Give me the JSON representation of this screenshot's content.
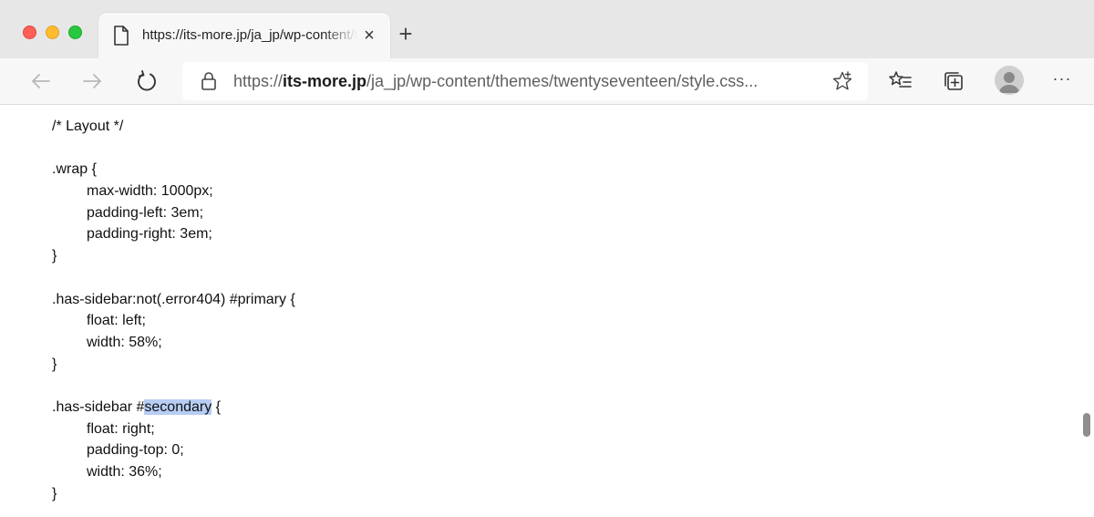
{
  "browser": {
    "tab": {
      "title": "https://its-more.jp/ja_jp/wp-content/themes/twentyseventeen/style.css",
      "close_glyph": "×",
      "icon": "page-icon"
    },
    "new_tab_glyph": "+",
    "toolbar": {
      "url_prefix": "https://",
      "url_domain": "its-more.jp",
      "url_path": "/ja_jp/wp-content/themes/twentyseventeen/style.css...",
      "more_glyph": "···",
      "icons": [
        "back-arrow-icon",
        "forward-arrow-icon",
        "refresh-icon",
        "lock-icon",
        "star-icon",
        "favorites-list-icon",
        "collections-icon",
        "profile-icon",
        "more-icon"
      ]
    }
  },
  "code": {
    "l1": "/* Layout */",
    "l2": "",
    "l3": ".wrap {",
    "l4": "max-width: 1000px;",
    "l5": "padding-left: 3em;",
    "l6": "padding-right: 3em;",
    "l7": "}",
    "l8": "",
    "l9": ".has-sidebar:not(.error404) #primary {",
    "l10": "float: left;",
    "l11": "width: 58%;",
    "l12": "}",
    "l13": "",
    "l14_before": ".has-sidebar #",
    "l14_highlight": "secondary",
    "l14_after": " {",
    "l15": "float: right;",
    "l16": "padding-top: 0;",
    "l17": "width: 36%;",
    "l18": "}"
  },
  "colors": {
    "highlight": "#b7cdf4",
    "tabstrip": "#e7e7e7",
    "toolbar": "#f7f7f7"
  }
}
